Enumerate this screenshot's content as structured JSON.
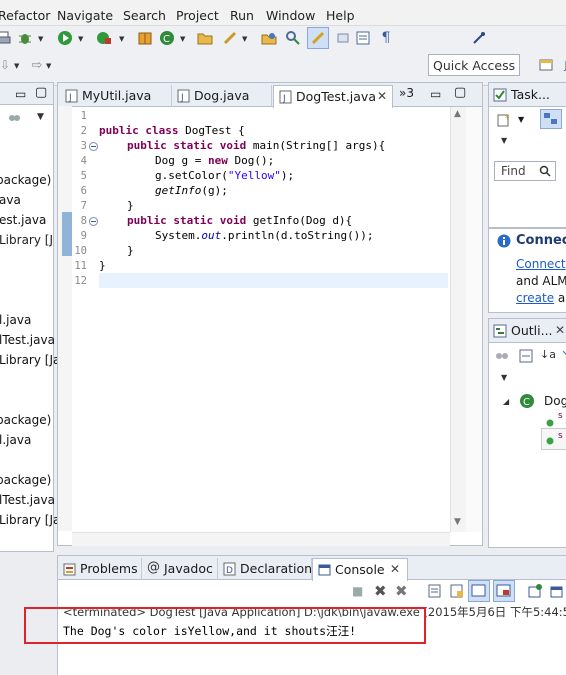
{
  "menu": [
    "Refactor",
    "Navigate",
    "Search",
    "Project",
    "Run",
    "Window",
    "Help"
  ],
  "quick_access": "Quick Access",
  "editor": {
    "tabs": [
      "MyUtil.java",
      "Dog.java",
      "DogTest.java"
    ],
    "overflow_label": "»3",
    "line_numbers": [
      "1",
      "2",
      "3",
      "4",
      "5",
      "6",
      "7",
      "8",
      "9",
      "10",
      "11",
      "12"
    ],
    "code": {
      "l2_kw1": "public class ",
      "l2_rest": "DogTest {",
      "l3_kw": "public static void ",
      "l3_rest": "main(String[] args){",
      "l4_a": "Dog g = ",
      "l4_kw": "new ",
      "l4_b": "Dog();",
      "l5_a": "g.setColor(",
      "l5_str": "\"Yellow\"",
      "l5_b": ");",
      "l6_it": "getInfo",
      "l6_b": "(g);",
      "l7": "}",
      "l8_kw": "public static void ",
      "l8_rest": "getInfo(Dog d){",
      "l9_a": "System.",
      "l9_out": "out",
      "l9_b": ".println(d.toString());",
      "l10": "}",
      "l11": "}"
    }
  },
  "explorer": {
    "items": [
      "package)",
      "ava",
      "est.java",
      "Library [J",
      "l.java",
      "lTest.java",
      "Library [Ja",
      "package)",
      "l.java",
      "package)",
      "lTest.java",
      "Library [Ja"
    ]
  },
  "right_panels": {
    "task_tab": "Task...",
    "find_placeholder": "Find",
    "connect_title": "Connec",
    "connect_link": "Connect",
    "connect_text": "and ALM",
    "create_link": "create",
    "create_suffix": " a",
    "outline_tab": "Outli...",
    "outline_root": "Dog",
    "outline_members": [
      "s",
      "s"
    ]
  },
  "bottom": {
    "tabs": [
      "Problems",
      "Javadoc",
      "Declaration",
      "Console"
    ],
    "console_header": "<terminated> DogTest [Java Application] D:\\jdk\\bin\\javaw.exe (2015年5月6日 下午5:44:5",
    "console_output": "The Dog's color isYellow,and it shouts汪汪!"
  },
  "colors": {
    "highlight_box": "#e0232a",
    "keyword": "#7f0055",
    "string": "#2a00ff",
    "link": "#1a5cc8"
  }
}
